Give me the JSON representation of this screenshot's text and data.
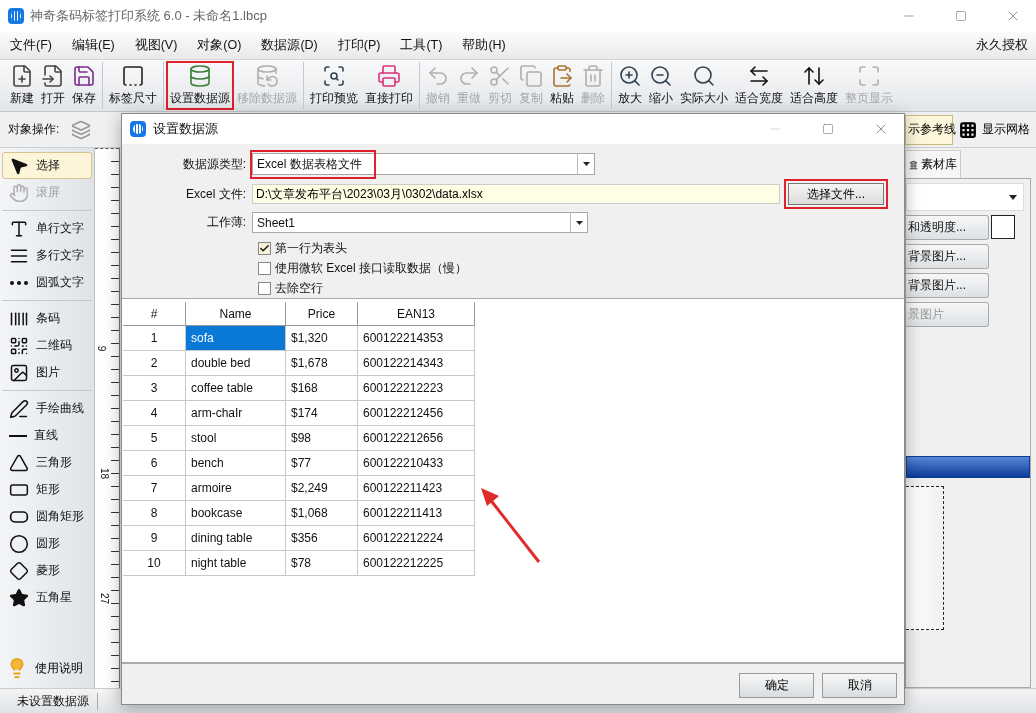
{
  "window": {
    "title": "神奇条码标签打印系统 6.0 - 未命名1.lbcp"
  },
  "menu": {
    "items": [
      "文件(F)",
      "编辑(E)",
      "视图(V)",
      "对象(O)",
      "数据源(D)",
      "打印(P)",
      "工具(T)",
      "帮助(H)"
    ],
    "license": "永久授权"
  },
  "toolbar": [
    [
      {
        "label": "新建",
        "kind": "new",
        "disabled": false,
        "highlighted": false
      },
      {
        "label": "打开",
        "kind": "open",
        "disabled": false,
        "highlighted": false
      },
      {
        "label": "保存",
        "kind": "save",
        "disabled": false,
        "highlighted": false
      }
    ],
    [
      {
        "label": "标签尺寸",
        "kind": "size",
        "disabled": false,
        "highlighted": false
      }
    ],
    [
      {
        "label": "设置数据源",
        "kind": "datasource",
        "disabled": false,
        "highlighted": true
      },
      {
        "label": "移除数据源",
        "kind": "removesource",
        "disabled": true,
        "highlighted": false
      }
    ],
    [
      {
        "label": "打印预览",
        "kind": "preview",
        "disabled": false,
        "highlighted": false
      },
      {
        "label": "直接打印",
        "kind": "print",
        "disabled": false,
        "highlighted": false
      }
    ],
    [
      {
        "label": "撤销",
        "kind": "undo",
        "disabled": true,
        "highlighted": false
      },
      {
        "label": "重做",
        "kind": "redo",
        "disabled": true,
        "highlighted": false
      },
      {
        "label": "剪切",
        "kind": "cut",
        "disabled": true,
        "highlighted": false
      },
      {
        "label": "复制",
        "kind": "copy",
        "disabled": true,
        "highlighted": false
      },
      {
        "label": "粘贴",
        "kind": "paste",
        "disabled": false,
        "highlighted": false
      },
      {
        "label": "删除",
        "kind": "delete",
        "disabled": true,
        "highlighted": false
      }
    ],
    [
      {
        "label": "放大",
        "kind": "zoomin",
        "disabled": false,
        "highlighted": false
      },
      {
        "label": "缩小",
        "kind": "zoomout",
        "disabled": false,
        "highlighted": false
      },
      {
        "label": "实际大小",
        "kind": "actual",
        "disabled": false,
        "highlighted": false
      },
      {
        "label": "适合宽度",
        "kind": "fitwidth",
        "disabled": false,
        "highlighted": false
      },
      {
        "label": "适合高度",
        "kind": "fitheight",
        "disabled": false,
        "highlighted": false
      },
      {
        "label": "整页显示",
        "kind": "fitpage",
        "disabled": true,
        "highlighted": false
      }
    ]
  ],
  "object_bar": {
    "label": "对象操作:",
    "guides": {
      "label": "示参考线",
      "on": true
    },
    "grid": {
      "label": "显示网格"
    }
  },
  "tools": {
    "groups": [
      [
        {
          "label": "选择",
          "kind": "pointer",
          "selected": true,
          "disabled": false
        },
        {
          "label": "滚屏",
          "kind": "hand",
          "selected": false,
          "disabled": true
        }
      ],
      [
        {
          "label": "单行文字",
          "kind": "text",
          "selected": false,
          "disabled": false
        },
        {
          "label": "多行文字",
          "kind": "multitext",
          "selected": false,
          "disabled": false
        },
        {
          "label": "圆弧文字",
          "kind": "arctext",
          "selected": false,
          "disabled": false
        }
      ],
      [
        {
          "label": "条码",
          "kind": "barcode",
          "selected": false,
          "disabled": false
        },
        {
          "label": "二维码",
          "kind": "qrcode",
          "selected": false,
          "disabled": false
        },
        {
          "label": "图片",
          "kind": "image",
          "selected": false,
          "disabled": false
        }
      ],
      [
        {
          "label": "手绘曲线",
          "kind": "freehand",
          "selected": false,
          "disabled": false
        },
        {
          "label": "直线",
          "kind": "line",
          "selected": false,
          "disabled": false
        },
        {
          "label": "三角形",
          "kind": "triangle",
          "selected": false,
          "disabled": false
        },
        {
          "label": "矩形",
          "kind": "rect",
          "selected": false,
          "disabled": false
        },
        {
          "label": "圆角矩形",
          "kind": "roundrect",
          "selected": false,
          "disabled": false
        },
        {
          "label": "圆形",
          "kind": "ellipse",
          "selected": false,
          "disabled": false
        },
        {
          "label": "菱形",
          "kind": "diamond",
          "selected": false,
          "disabled": false
        },
        {
          "label": "五角星",
          "kind": "star",
          "selected": false,
          "disabled": false
        }
      ]
    ],
    "help": "使用说明"
  },
  "ruler": {
    "labels": [
      "9",
      "18",
      "27"
    ]
  },
  "side_panel": {
    "tab": "素材库",
    "buttons": [
      {
        "label": "和透明度...",
        "disabled": false
      },
      {
        "label": "背景图片...",
        "disabled": false
      },
      {
        "label": "背景图片...",
        "disabled": false
      },
      {
        "label": "景图片",
        "disabled": true
      }
    ]
  },
  "status_bar": {
    "data_source": "未设置数据源"
  },
  "dialog": {
    "title": "设置数据源",
    "source_type": {
      "label": "数据源类型:",
      "value": "Excel 数据表格文件",
      "highlighted": true
    },
    "file": {
      "label": "Excel 文件:",
      "value": "D:\\文章发布平台\\2023\\03月\\0302\\data.xlsx",
      "button": "选择文件...",
      "highlighted": true
    },
    "sheet": {
      "label": "工作薄:",
      "value": "Sheet1"
    },
    "options": [
      {
        "label": "第一行为表头",
        "checked": true
      },
      {
        "label": "使用微软 Excel 接口读取数据（慢）",
        "checked": false
      },
      {
        "label": "去除空行",
        "checked": false
      }
    ],
    "table": {
      "columns": [
        "#",
        "Name",
        "Price",
        "EAN13"
      ],
      "rows": [
        {
          "cells": [
            "1",
            "sofa",
            "$1,320",
            "600122214353"
          ],
          "selected": true
        },
        {
          "cells": [
            "2",
            "double bed",
            "$1,678",
            "600122214343"
          ],
          "selected": false
        },
        {
          "cells": [
            "3",
            "coffee table",
            "$168",
            "600122212223"
          ],
          "selected": false
        },
        {
          "cells": [
            "4",
            "arm-chaIr",
            "$174",
            "600122212456"
          ],
          "selected": false
        },
        {
          "cells": [
            "5",
            "stool",
            "$98",
            "600122212656"
          ],
          "selected": false
        },
        {
          "cells": [
            "6",
            "bench",
            "$77",
            "600122210433"
          ],
          "selected": false
        },
        {
          "cells": [
            "7",
            "armoire",
            "$2,249",
            "600122211423"
          ],
          "selected": false
        },
        {
          "cells": [
            "8",
            "bookcase",
            "$1,068",
            "600122211413"
          ],
          "selected": false
        },
        {
          "cells": [
            "9",
            "dining table",
            "$356",
            "600122212224"
          ],
          "selected": false
        },
        {
          "cells": [
            "10",
            "night table",
            "$78",
            "600122212225"
          ],
          "selected": false
        }
      ]
    },
    "buttons": [
      "确定",
      "取消"
    ]
  }
}
